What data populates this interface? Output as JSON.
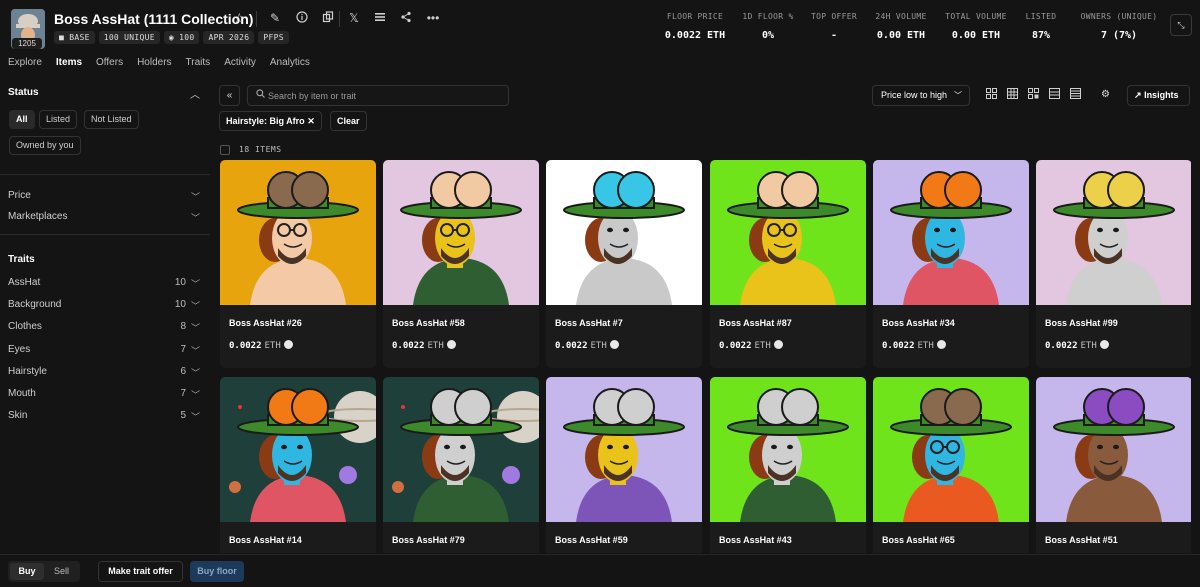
{
  "header": {
    "avatar_badge": "1205",
    "title": "Boss AssHat (1111 Collection)",
    "chips": [
      "BASE",
      "100 UNIQUE",
      "100",
      "APR 2026",
      "PFPS"
    ],
    "stats": [
      {
        "label": "FLOOR PRICE",
        "value": "0.0022 ETH"
      },
      {
        "label": "1D FLOOR %",
        "value": "0%"
      },
      {
        "label": "TOP OFFER",
        "value": "-"
      },
      {
        "label": "24H VOLUME",
        "value": "0.00 ETH"
      },
      {
        "label": "TOTAL VOLUME",
        "value": "0.00 ETH"
      },
      {
        "label": "LISTED",
        "value": "87%"
      },
      {
        "label": "OWNERS (UNIQUE)",
        "value": "7 (7%)"
      }
    ]
  },
  "tabs": [
    "Explore",
    "Items",
    "Offers",
    "Holders",
    "Traits",
    "Activity",
    "Analytics"
  ],
  "active_tab": "Items",
  "sidebar": {
    "status_heading": "Status",
    "status_options": [
      "All",
      "Listed",
      "Not Listed",
      "Owned by you"
    ],
    "price_label": "Price",
    "marketplaces_label": "Marketplaces",
    "traits_heading": "Traits",
    "traits": [
      {
        "name": "AssHat",
        "count": "10"
      },
      {
        "name": "Background",
        "count": "10"
      },
      {
        "name": "Clothes",
        "count": "8"
      },
      {
        "name": "Eyes",
        "count": "7"
      },
      {
        "name": "Hairstyle",
        "count": "6"
      },
      {
        "name": "Mouth",
        "count": "7"
      },
      {
        "name": "Skin",
        "count": "5"
      }
    ]
  },
  "toolbar": {
    "search_placeholder": "Search by item or trait",
    "sort_label": "Price low to high",
    "insights_label": "Insights",
    "active_filter": "Hairstyle: Big Afro",
    "clear_label": "Clear",
    "items_count": "18 ITEMS"
  },
  "items": [
    {
      "name": "Boss AssHat #26",
      "price": "0.0022",
      "unit": "ETH",
      "bg": "#e8a40c",
      "hat": "#8a6a4e",
      "skin": "#f3c9a6",
      "clothes": "none",
      "glasses": true
    },
    {
      "name": "Boss AssHat #58",
      "price": "0.0022",
      "unit": "ETH",
      "bg": "#e3c6df",
      "hat": "#f1c9a2",
      "skin": "#e9c21a",
      "clothes": "#2f5e33",
      "glasses": true
    },
    {
      "name": "Boss AssHat #7",
      "price": "0.0022",
      "unit": "ETH",
      "bg": "#ffffff",
      "hat": "#37c6e6",
      "skin": "#c9c9c9",
      "clothes": "none",
      "glasses": false
    },
    {
      "name": "Boss AssHat #87",
      "price": "0.0022",
      "unit": "ETH",
      "bg": "#6fe41a",
      "hat": "#f1c9a2",
      "skin": "#e9c21a",
      "clothes": "none",
      "glasses": true
    },
    {
      "name": "Boss AssHat #34",
      "price": "0.0022",
      "unit": "ETH",
      "bg": "#c5b6ec",
      "hat": "#f17a17",
      "skin": "#2fb7e2",
      "clothes": "#e05563",
      "glasses": false
    },
    {
      "name": "Boss AssHat #99",
      "price": "0.0022",
      "unit": "ETH",
      "bg": "#e3c6df",
      "hat": "#ecd04a",
      "skin": "#cfcfcf",
      "clothes": "none",
      "glasses": false
    },
    {
      "name": "Boss AssHat #14",
      "price": "",
      "unit": "",
      "bg": "#1f3f3a",
      "hat": "#f17a17",
      "skin": "#2fb7e2",
      "clothes": "#e05563",
      "glasses": false
    },
    {
      "name": "Boss AssHat #79",
      "price": "",
      "unit": "",
      "bg": "#1f3f3a",
      "hat": "#cfcfcf",
      "skin": "#cfcfcf",
      "clothes": "#2f5e33",
      "glasses": false
    },
    {
      "name": "Boss AssHat #59",
      "price": "",
      "unit": "",
      "bg": "#c5b6ec",
      "hat": "#cfcfcf",
      "skin": "#e9c21a",
      "clothes": "#7d55b8",
      "glasses": false
    },
    {
      "name": "Boss AssHat #43",
      "price": "",
      "unit": "",
      "bg": "#6fe41a",
      "hat": "#cfcfcf",
      "skin": "#cfcfcf",
      "clothes": "#2f5e33",
      "glasses": false
    },
    {
      "name": "Boss AssHat #65",
      "price": "",
      "unit": "",
      "bg": "#6fe41a",
      "hat": "#8a6a4e",
      "skin": "#2fb7e2",
      "clothes": "#ea5a20",
      "glasses": true
    },
    {
      "name": "Boss AssHat #51",
      "price": "",
      "unit": "",
      "bg": "#c5b6ec",
      "hat": "#8b4cc2",
      "skin": "#8a5a3c",
      "clothes": "none",
      "glasses": false
    }
  ],
  "bottom": {
    "buy_label": "Buy",
    "sell_label": "Sell",
    "trait_offer_label": "Make trait offer",
    "buy_floor_label": "Buy floor"
  }
}
